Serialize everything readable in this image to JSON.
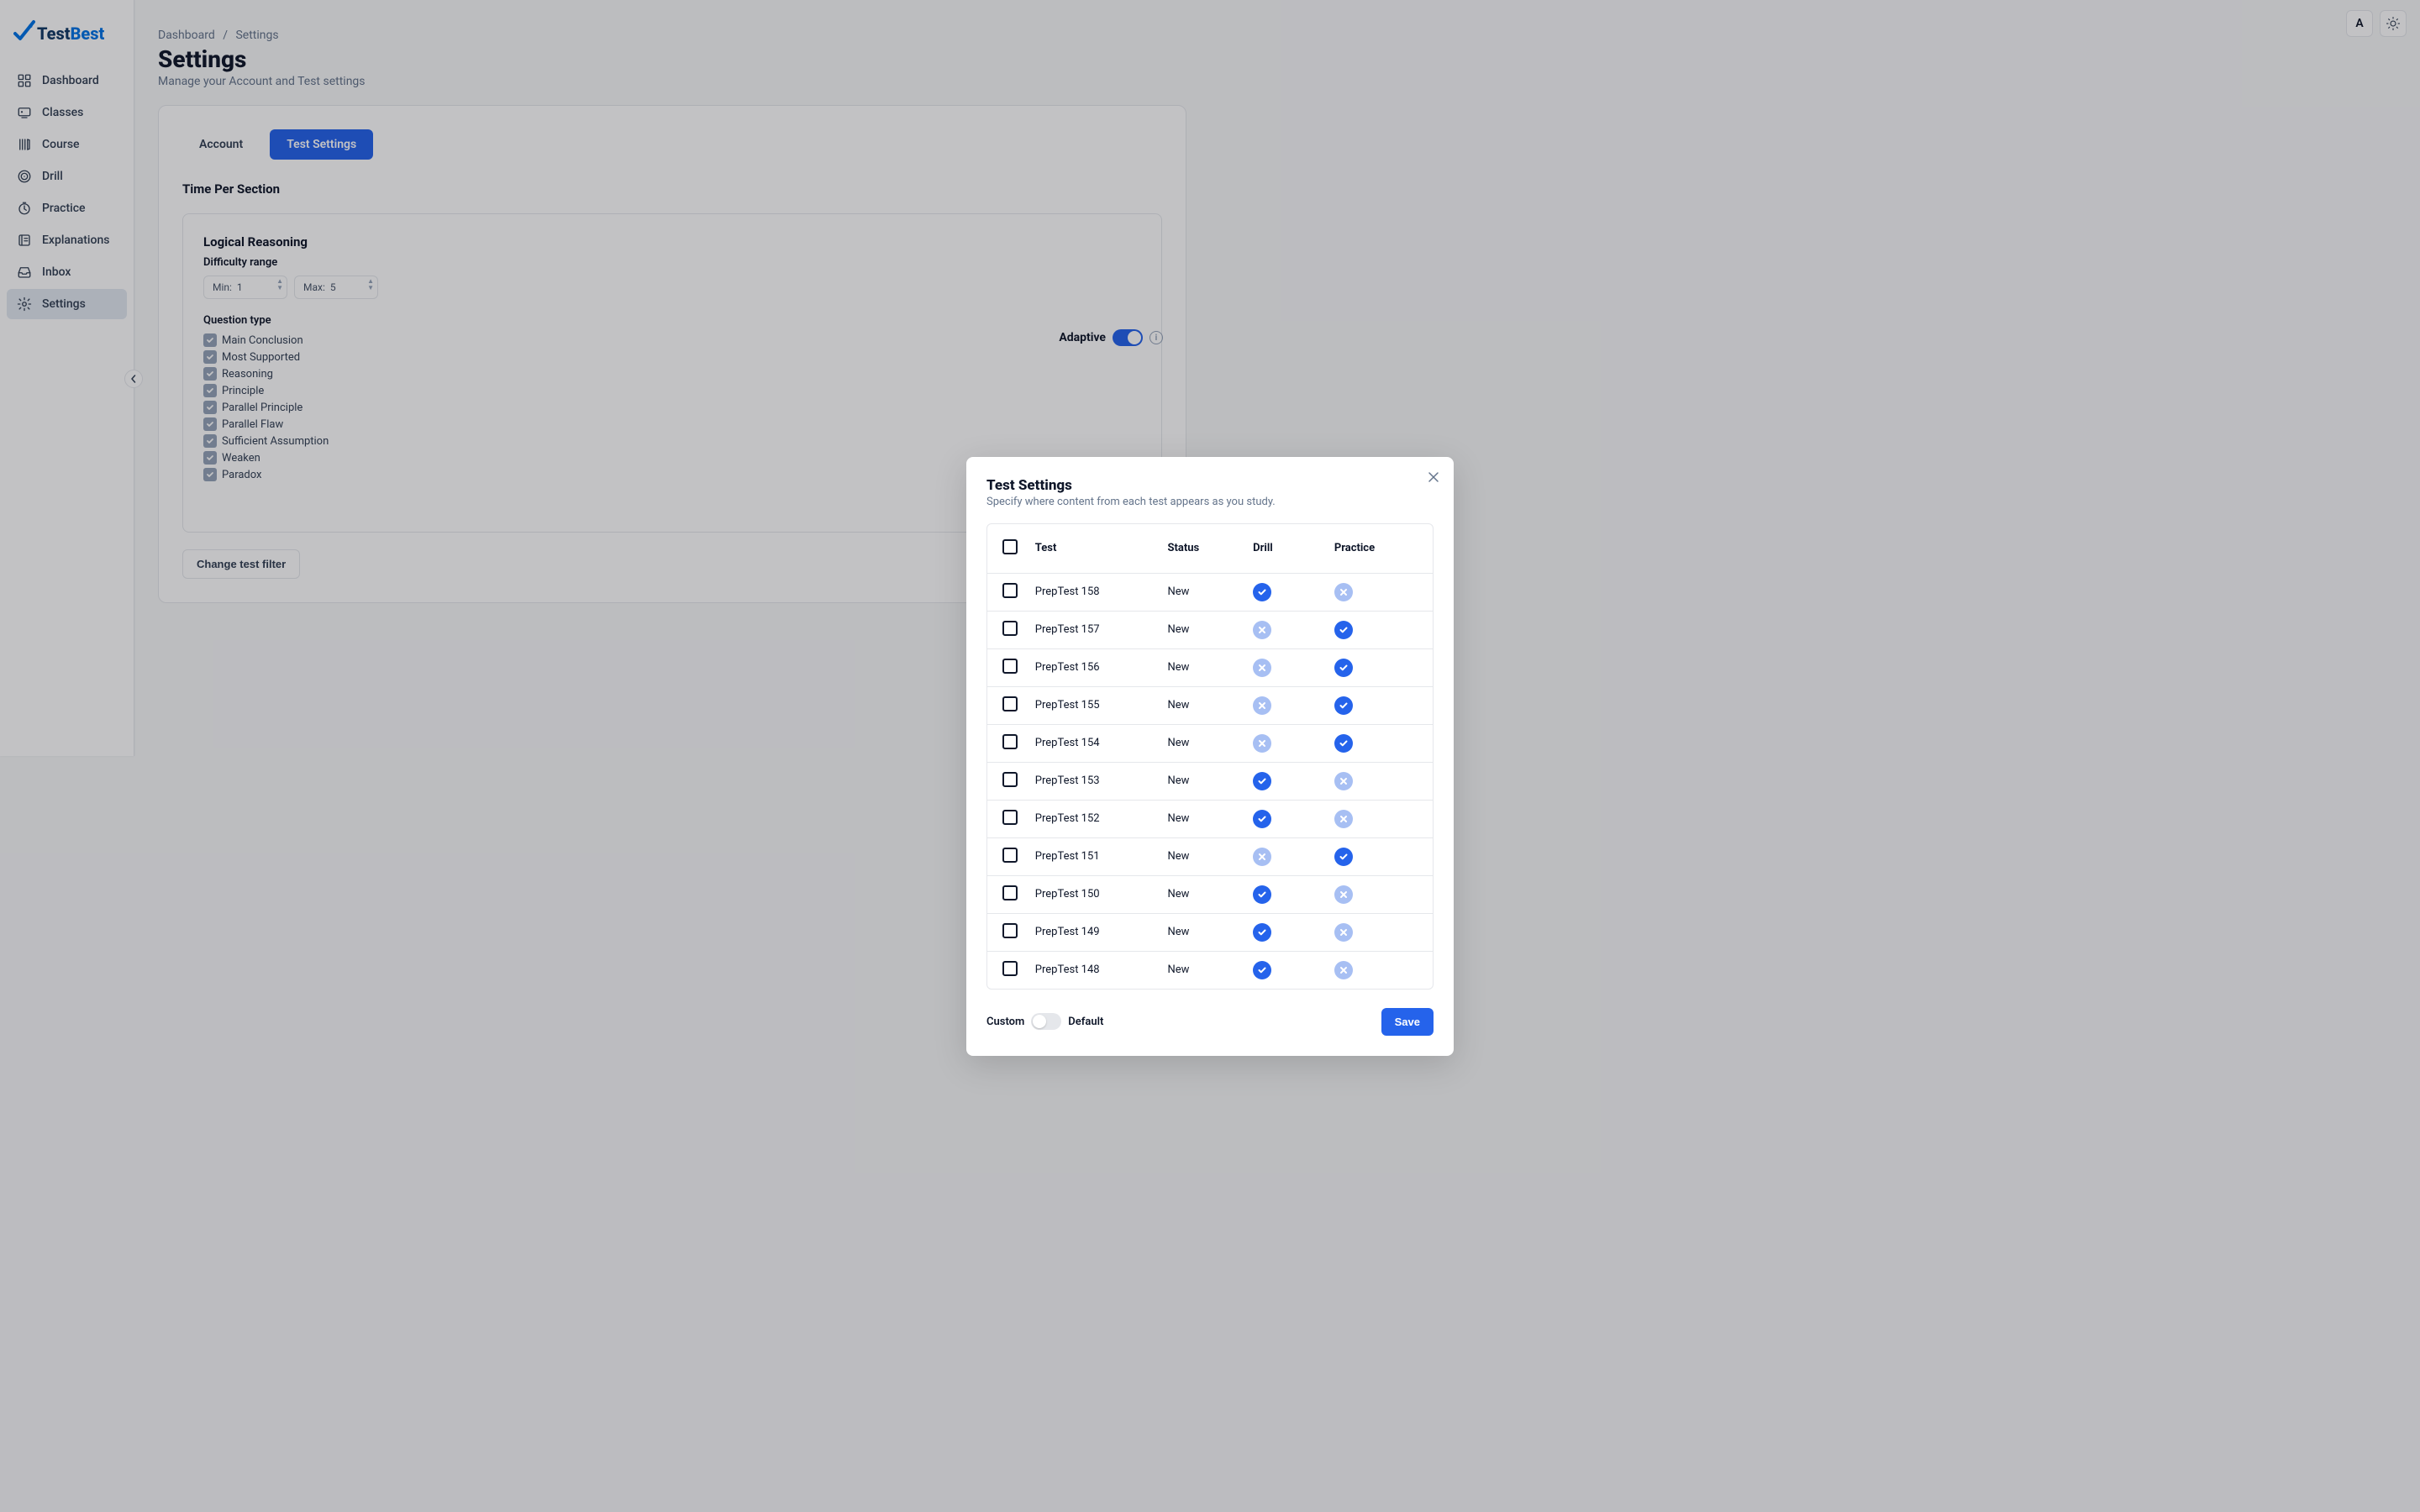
{
  "brand": {
    "name": "TestBest"
  },
  "topbar": {
    "avatar_letter": "A"
  },
  "nav": {
    "items": [
      {
        "label": "Dashboard",
        "icon": "dashboard-icon"
      },
      {
        "label": "Classes",
        "icon": "classes-icon"
      },
      {
        "label": "Course",
        "icon": "course-icon"
      },
      {
        "label": "Drill",
        "icon": "drill-icon"
      },
      {
        "label": "Practice",
        "icon": "practice-icon"
      },
      {
        "label": "Explanations",
        "icon": "explanations-icon"
      },
      {
        "label": "Inbox",
        "icon": "inbox-icon"
      },
      {
        "label": "Settings",
        "icon": "settings-icon"
      }
    ],
    "selected_index": 7
  },
  "breadcrumb": {
    "root": "Dashboard",
    "current": "Settings"
  },
  "page": {
    "title": "Settings",
    "subtitle": "Manage your Account and Test settings"
  },
  "tabs": {
    "items": [
      {
        "label": "Account"
      },
      {
        "label": "Test Settings"
      }
    ],
    "active_index": 1
  },
  "time_section": {
    "title": "Time Per Section"
  },
  "logical_reasoning": {
    "title": "Logical Reasoning",
    "difficulty_label": "Difficulty range",
    "min_label": "Min:",
    "min_value": "1",
    "max_label": "Max:",
    "max_value": "5",
    "question_type_label": "Question type",
    "types": [
      "Main Conclusion",
      "Most Supported",
      "Reasoning",
      "Principle",
      "Parallel Principle",
      "Parallel Flaw",
      "Sufficient Assumption",
      "Weaken",
      "Paradox"
    ],
    "adaptive_label": "Adaptive"
  },
  "buttons": {
    "change_filter": "Change test filter",
    "save": "Save"
  },
  "modal": {
    "title": "Test Settings",
    "description": "Specify where content from each test appears as you study.",
    "columns": {
      "test": "Test",
      "status": "Status",
      "drill": "Drill",
      "practice": "Practice"
    },
    "rows": [
      {
        "test": "PrepTest 158",
        "status": "New",
        "drill": true,
        "practice": false
      },
      {
        "test": "PrepTest 157",
        "status": "New",
        "drill": false,
        "practice": true
      },
      {
        "test": "PrepTest 156",
        "status": "New",
        "drill": false,
        "practice": true
      },
      {
        "test": "PrepTest 155",
        "status": "New",
        "drill": false,
        "practice": true
      },
      {
        "test": "PrepTest 154",
        "status": "New",
        "drill": false,
        "practice": true
      },
      {
        "test": "PrepTest 153",
        "status": "New",
        "drill": true,
        "practice": false
      },
      {
        "test": "PrepTest 152",
        "status": "New",
        "drill": true,
        "practice": false
      },
      {
        "test": "PrepTest 151",
        "status": "New",
        "drill": false,
        "practice": true
      },
      {
        "test": "PrepTest 150",
        "status": "New",
        "drill": true,
        "practice": false
      },
      {
        "test": "PrepTest 149",
        "status": "New",
        "drill": true,
        "practice": false
      },
      {
        "test": "PrepTest 148",
        "status": "New",
        "drill": true,
        "practice": false
      }
    ],
    "mode": {
      "custom": "Custom",
      "default": "Default"
    },
    "save": "Save"
  }
}
